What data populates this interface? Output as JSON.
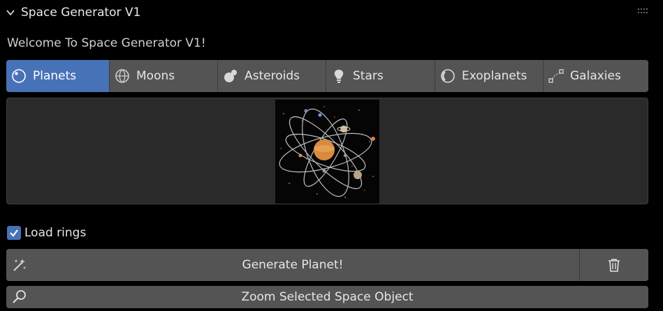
{
  "panel": {
    "title": "Space Generator V1",
    "welcome": "Welcome To Space Generator V1!"
  },
  "tabs": [
    {
      "label": "Planets",
      "icon": "planet-icon",
      "active": true
    },
    {
      "label": "Moons",
      "icon": "moon-icon",
      "active": false
    },
    {
      "label": "Asteroids",
      "icon": "asteroid-icon",
      "active": false
    },
    {
      "label": "Stars",
      "icon": "star-bulb-icon",
      "active": false
    },
    {
      "label": "Exoplanets",
      "icon": "exoplanet-icon",
      "active": false
    },
    {
      "label": "Galaxies",
      "icon": "galaxy-icon",
      "active": false
    }
  ],
  "preview": {
    "image_desc": "planet-system-thumbnail"
  },
  "options": {
    "load_rings_label": "Load rings",
    "load_rings_checked": true
  },
  "actions": {
    "generate_label": "Generate Planet!",
    "zoom_label": "Zoom Selected Space Object"
  },
  "colors": {
    "accent": "#4872b8",
    "button": "#545454",
    "panel_bg": "#000000",
    "preview_bg": "#2a2a2a"
  }
}
